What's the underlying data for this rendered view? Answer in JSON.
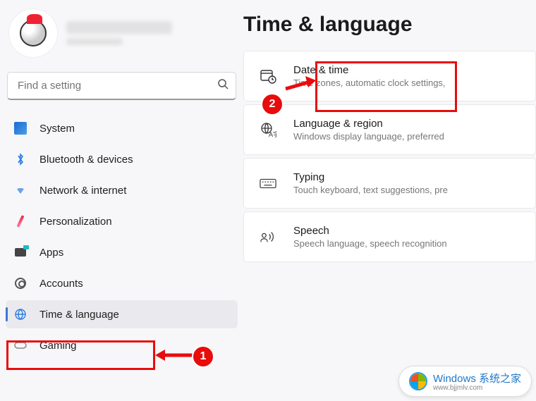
{
  "search": {
    "placeholder": "Find a setting"
  },
  "sidebar": {
    "items": [
      {
        "label": "System"
      },
      {
        "label": "Bluetooth & devices"
      },
      {
        "label": "Network & internet"
      },
      {
        "label": "Personalization"
      },
      {
        "label": "Apps"
      },
      {
        "label": "Accounts"
      },
      {
        "label": "Time & language"
      },
      {
        "label": "Gaming"
      }
    ]
  },
  "page": {
    "title": "Time & language"
  },
  "cards": [
    {
      "title": "Date & time",
      "sub": "Time zones, automatic clock settings,"
    },
    {
      "title": "Language & region",
      "sub": "Windows display language, preferred"
    },
    {
      "title": "Typing",
      "sub": "Touch keyboard, text suggestions, pre"
    },
    {
      "title": "Speech",
      "sub": "Speech language, speech recognition"
    }
  ],
  "annotations": {
    "step1": "1",
    "step2": "2"
  },
  "watermark": {
    "brand": "Windows 系统之家",
    "url": "www.bjjmlv.com"
  }
}
